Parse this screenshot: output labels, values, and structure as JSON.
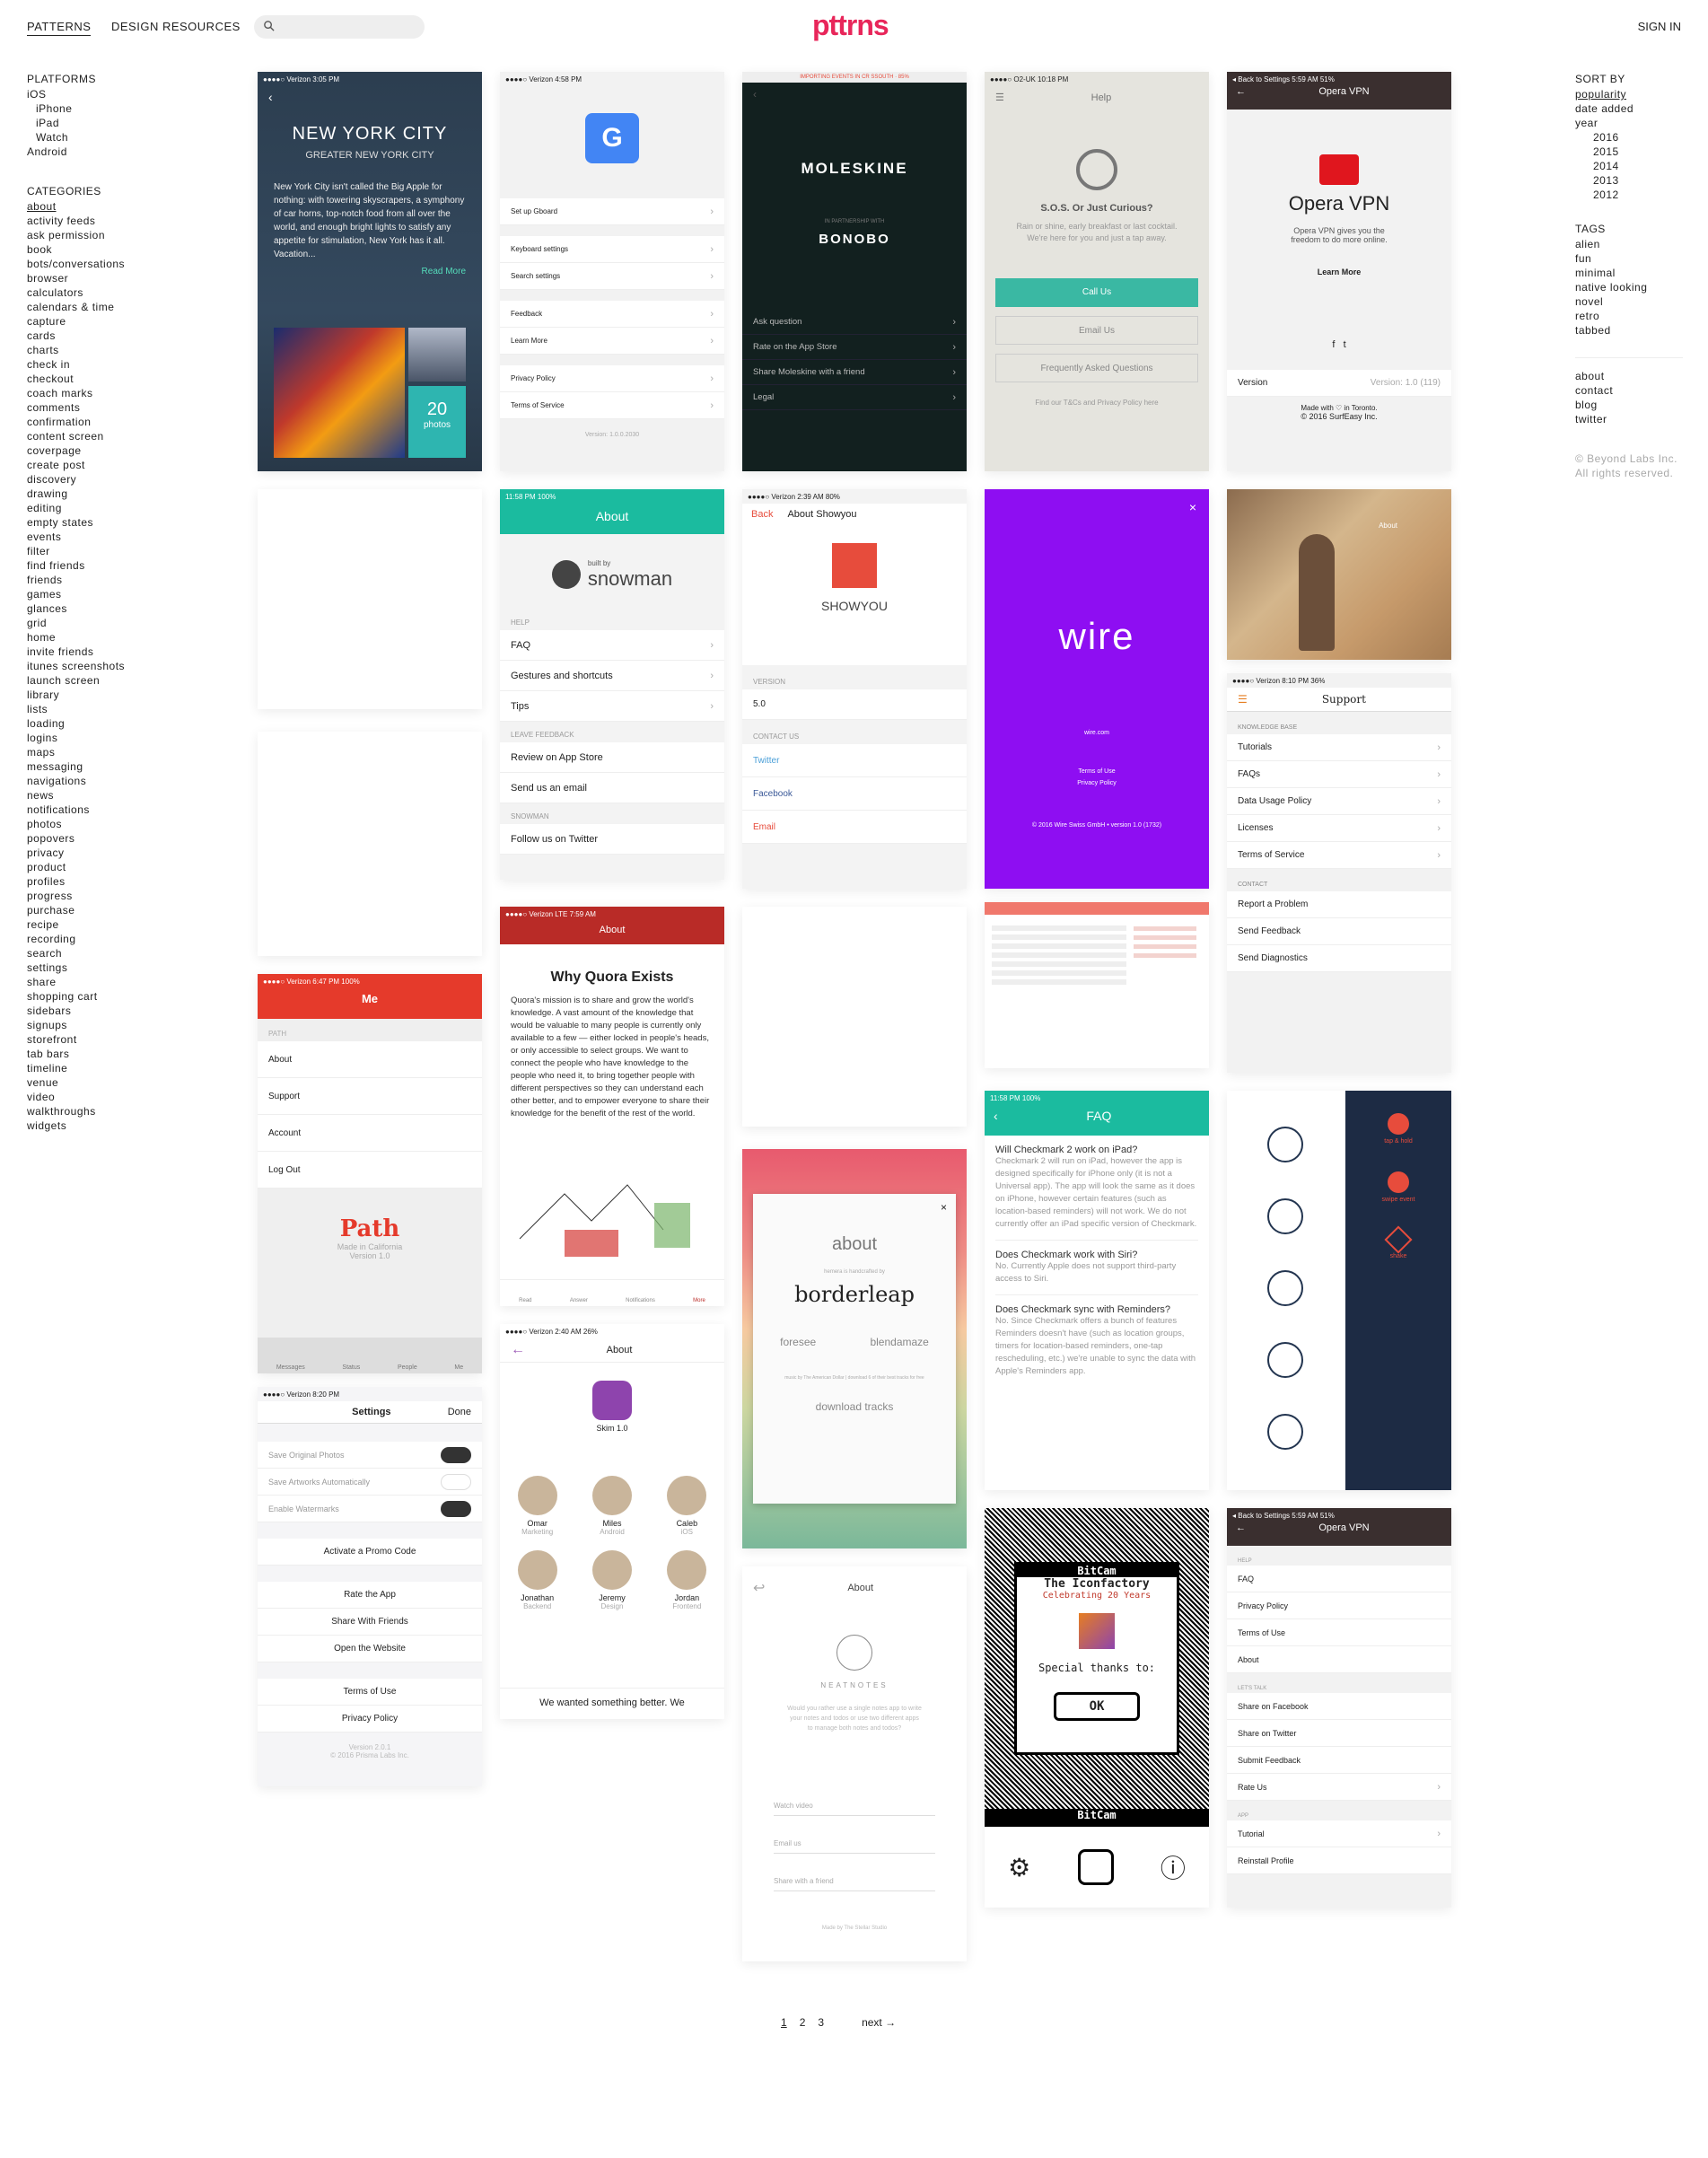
{
  "header": {
    "nav": [
      "PATTERNS",
      "DESIGN RESOURCES"
    ],
    "logo": "pttrns",
    "signin": "SIGN IN"
  },
  "left": {
    "platforms_title": "PLATFORMS",
    "ios": "iOS",
    "ios_sub": [
      "iPhone",
      "iPad",
      "Watch"
    ],
    "android": "Android",
    "categories_title": "CATEGORIES",
    "categories": [
      "about",
      "activity feeds",
      "ask permission",
      "book",
      "bots/conversations",
      "browser",
      "calculators",
      "calendars & time",
      "capture",
      "cards",
      "charts",
      "check in",
      "checkout",
      "coach marks",
      "comments",
      "confirmation",
      "content screen",
      "coverpage",
      "create post",
      "discovery",
      "drawing",
      "editing",
      "empty states",
      "events",
      "filter",
      "find friends",
      "friends",
      "games",
      "glances",
      "grid",
      "home",
      "invite friends",
      "itunes screenshots",
      "launch screen",
      "library",
      "lists",
      "loading",
      "logins",
      "maps",
      "messaging",
      "navigations",
      "news",
      "notifications",
      "photos",
      "popovers",
      "privacy",
      "product",
      "profiles",
      "progress",
      "purchase",
      "recipe",
      "recording",
      "search",
      "settings",
      "share",
      "shopping cart",
      "sidebars",
      "signups",
      "storefront",
      "tab bars",
      "timeline",
      "venue",
      "video",
      "walkthroughs",
      "widgets"
    ]
  },
  "right": {
    "sort_title": "SORT BY",
    "sort": [
      "popularity",
      "date added",
      "year"
    ],
    "years": [
      "2016",
      "2015",
      "2014",
      "2013",
      "2012"
    ],
    "tags_title": "TAGS",
    "tags": [
      "alien",
      "fun",
      "minimal",
      "native looking",
      "novel",
      "retro",
      "tabbed"
    ],
    "links": [
      "about",
      "contact",
      "blog",
      "twitter"
    ],
    "copyright": [
      "© Beyond Labs Inc.",
      "All rights reserved."
    ]
  },
  "cards": {
    "nyc": {
      "status": "●●●●○ Verizon  3:05 PM",
      "title": "NEW YORK CITY",
      "subtitle": "GREATER NEW YORK CITY",
      "body": "New York City isn't called the Big Apple for nothing: with towering skyscrapers, a symphony of car horns, top-notch food from all over the world, and enough bright lights to satisfy any appetite for stimulation, New York has it all. Vacation...",
      "more": "Read More",
      "count": "20",
      "count_label": "photos"
    },
    "gboard": {
      "status": "●●●●○ Verizon   4:58 PM",
      "rows": [
        "Set up Gboard",
        "Keyboard settings",
        "Search settings",
        "Feedback",
        "Learn More",
        "Privacy Policy",
        "Terms of Service"
      ],
      "version": "Version: 1.0.0.2030"
    },
    "moleskine": {
      "banner": "IMPORTING EVENTS IN CR SSOUTH · 85%",
      "brand": "MOLESKINE",
      "partner": "IN PARTNERSHIP WITH",
      "partner_name": "BONOBO",
      "rows": [
        "Ask question",
        "Rate on the App Store",
        "Share Moleskine with a friend",
        "Legal"
      ]
    },
    "help": {
      "status": "●●●●○ O2-UK   10:18 PM",
      "title": "Help",
      "heading": "S.O.S. Or Just Curious?",
      "body": "Rain or shine, early breakfast or last cocktail. We're here for you and just a tap away.",
      "buttons": [
        "Call Us",
        "Email Us",
        "Frequently Asked Questions"
      ],
      "footer": "Find our T&Cs and Privacy Policy here"
    },
    "opera": {
      "status": "◂ Back to Settings   5:59 AM   51%",
      "title": "Opera VPN",
      "name": "Opera VPN",
      "body": "Opera VPN gives you the freedom to do more online.",
      "learn": "Learn More",
      "version_label": "Version",
      "version": "Version: 1.0 (119)",
      "made": "Made with ♡ in Toronto.",
      "copy": "© 2016 SurfEasy Inc."
    },
    "snowman": {
      "status": "11:58 PM  100%",
      "title": "About",
      "brand_small": "built by",
      "brand": "snowman",
      "sec1": "HELP",
      "rows1": [
        "FAQ",
        "Gestures and shortcuts",
        "Tips"
      ],
      "sec2": "LEAVE FEEDBACK",
      "rows2": [
        "Review on App Store",
        "Send us an email"
      ],
      "sec3": "SNOWMAN",
      "rows3": [
        "Follow us on Twitter"
      ]
    },
    "showyou": {
      "status": "●●●●○ Verizon  2:39 AM  80%",
      "back": "Back",
      "title": "About Showyou",
      "name": "SHOWYOU",
      "sec1": "VERSION",
      "version": "5.0",
      "sec2": "CONTACT US",
      "links": [
        "Twitter",
        "Facebook",
        "Email"
      ]
    },
    "wire": {
      "logo": "wire",
      "site": "wire.com",
      "links": [
        "Terms of Use",
        "Privacy Policy"
      ],
      "copy": "© 2016 Wire Swiss GmbH • version 1.0 (1732)"
    },
    "desert": {
      "title": "About"
    },
    "support": {
      "status": "●●●●○ Verizon   8:10 PM   36%",
      "title": "Support",
      "sec1": "KNOWLEDGE BASE",
      "rows1": [
        "Tutorials",
        "FAQs",
        "Data Usage Policy",
        "Licenses",
        "Terms of Service"
      ],
      "sec2": "CONTACT",
      "rows2": [
        "Report a Problem",
        "Send Feedback",
        "Send Diagnostics"
      ]
    },
    "path": {
      "status": "●●●●○ Verizon  6:47 PM  100%",
      "title": "Me",
      "sec": "PATH",
      "rows": [
        "About",
        "Support",
        "Account",
        "Log Out"
      ],
      "brand": "Path",
      "made": "Made in California",
      "version": "Version 1.0",
      "tabs": [
        "Messages",
        "Status",
        "People",
        "Me"
      ]
    },
    "quora": {
      "status": "●●●●○ Verizon  LTE  7:59 AM",
      "title": "About",
      "heading": "Why Quora Exists",
      "body": "Quora's mission is to share and grow the world's knowledge. A vast amount of the knowledge that would be valuable to many people is currently only available to a few — either locked in people's heads, or only accessible to select groups. We want to connect the people who have knowledge to the people who need it, to bring together people with different perspectives so they can understand each other better, and to empower everyone to share their knowledge for the benefit of the rest of the world.",
      "tabs": [
        "Read",
        "Answer",
        "Notifications",
        "More"
      ]
    },
    "checkmark": {
      "status": "11:58 PM  100%",
      "title": "FAQ",
      "q": [
        {
          "q": "Will Checkmark 2 work on iPad?",
          "a": "Checkmark 2 will run on iPad, however the app is designed specifically for iPhone only (it is not a Universal app). The app will look the same as it does on iPhone, however certain features (such as location-based reminders) will not work. We do not currently offer an iPad specific version of Checkmark."
        },
        {
          "q": "Does Checkmark work with Siri?",
          "a": "No. Currently Apple does not support third-party access to Siri."
        },
        {
          "q": "Does Checkmark sync with Reminders?",
          "a": "No. Since Checkmark offers a bunch of features Reminders doesn't have (such as location groups, timers for location-based reminders, one-tap rescheduling, etc.) we're unable to sync the data with Apple's Reminders app."
        }
      ]
    },
    "borderleap": {
      "title": "about",
      "small": "hemera is handcrafted by",
      "brand": "borderleap",
      "left": "foresee",
      "right": "blendamaze",
      "music": "music by The American Dollar | download 6 of their best tracks for free",
      "dl": "download tracks"
    },
    "prisma": {
      "status": "●●●●○ Verizon   8:20 PM",
      "title": "Settings",
      "done": "Done",
      "toggles": [
        "Save Original Photos",
        "Save Artworks Automatically",
        "Enable Watermarks"
      ],
      "promo": "Activate a Promo Code",
      "rows": [
        "Rate the App",
        "Share With Friends",
        "Open the Website"
      ],
      "legal": [
        "Terms of Use",
        "Privacy Policy"
      ],
      "version": "Version 2.0.1",
      "copy": "© 2016 Prisma Labs Inc."
    },
    "skim": {
      "status": "●●●●○ Verizon  2:40 AM  26%",
      "title": "About",
      "app": "Skim 1.0",
      "team": [
        {
          "name": "Omar",
          "role": "Marketing"
        },
        {
          "name": "Miles",
          "role": "Android"
        },
        {
          "name": "Caleb",
          "role": "iOS"
        },
        {
          "name": "Jonathan",
          "role": "Backend"
        },
        {
          "name": "Jeremy",
          "role": "Design"
        },
        {
          "name": "Jordan",
          "role": "Frontend"
        }
      ],
      "tagline": "We wanted something better. We"
    },
    "neatnotes": {
      "title": "About",
      "name": "NEATNOTES",
      "body": "Would you rather use a single notes app to write your notes and todos or use two different apps to manage both notes and todos?",
      "rows": [
        "Watch video",
        "Email us",
        "Share with a friend"
      ],
      "made": "Made by The Stellar Studio"
    },
    "gestures": {
      "items": [
        "tap & hold",
        "swipe event",
        "shake"
      ]
    },
    "bitcam": {
      "title": "BitCam",
      "line1": "The Iconfactory",
      "line2": "Celebrating 20 Years",
      "thanks": "Special thanks to:",
      "ok": "OK",
      "footer": "BitCam"
    },
    "opera2": {
      "status": "◂ Back to Settings   5:59 AM   51%",
      "title": "Opera VPN",
      "sec1": "HELP",
      "rows1": [
        "FAQ",
        "Privacy Policy",
        "Terms of Use",
        "About"
      ],
      "sec2": "LET'S TALK",
      "rows2": [
        "Share on Facebook",
        "Share on Twitter",
        "Submit Feedback",
        "Rate Us"
      ],
      "sec3": "APP",
      "rows3": [
        "Tutorial",
        "Reinstall Profile"
      ]
    }
  },
  "pager": {
    "pages": [
      "1",
      "2",
      "3"
    ],
    "next": "next →"
  }
}
